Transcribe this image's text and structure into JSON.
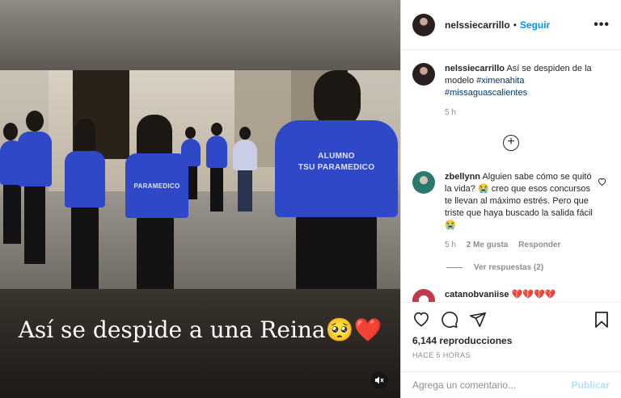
{
  "post": {
    "author": "nelssiecarrillo",
    "follow_label": "Seguir",
    "more_label": "•••",
    "caption_text": "Así se despiden de la modelo",
    "hashtags": [
      "#ximenahita",
      "#missaguascalientes"
    ],
    "time": "5 h"
  },
  "video": {
    "overlay_caption": "Así se despide a una Reina",
    "emoji_pleading": "🥺",
    "emoji_heart": "❤️",
    "shirt_text_line1": "ALUMNO",
    "shirt_text_line2": "TSU PARAMEDICO",
    "small_shirt_text": "PARAMEDICO",
    "mute_icon": "speaker-muted-icon",
    "colors": {
      "shirt": "#2f48c7",
      "caption": "#ffffff",
      "heart": "#e0141e"
    }
  },
  "comments": [
    {
      "user": "zbellynn",
      "text": "Alguien sabe cómo se quitó la vida? 😭 creo que esos concursos te llevan al máximo estrés. Pero que triste que haya buscado la salida fácil 😭",
      "time": "5 h",
      "likes": "2 Me gusta",
      "reply_label": "Responder",
      "view_replies": "Ver respuestas (2)"
    },
    {
      "user": "catanobvaniise",
      "text": "💔💔💔💔"
    }
  ],
  "load_more_icon": "plus-circle-icon",
  "actions": {
    "icons": [
      "heart-icon",
      "comment-icon",
      "share-icon",
      "bookmark-icon"
    ],
    "views": "6,144 reproducciones",
    "posted_ago": "HACE 5 HORAS"
  },
  "comment_box": {
    "placeholder": "Agrega un comentario...",
    "publish_label": "Publicar"
  },
  "colors": {
    "link": "#0095f6",
    "hashtag": "#00376b",
    "muted": "#8e8e8e",
    "publish_disabled": "#b2dffc"
  }
}
